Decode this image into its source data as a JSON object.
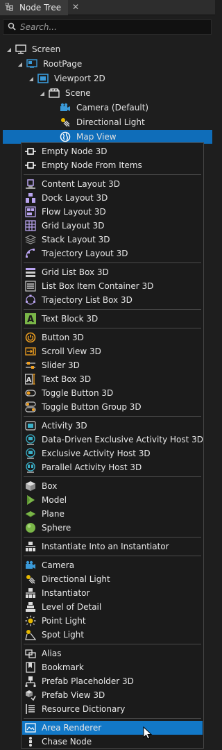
{
  "tab": {
    "title": "Node Tree"
  },
  "search": {
    "placeholder": "Search..."
  },
  "tree": [
    {
      "label": "Screen",
      "icon": "screen-icon"
    },
    {
      "label": "RootPage",
      "icon": "page-icon"
    },
    {
      "label": "Viewport 2D",
      "icon": "viewport-icon"
    },
    {
      "label": "Scene",
      "icon": "scene-icon"
    },
    {
      "label": "Camera (Default)",
      "icon": "camera-icon"
    },
    {
      "label": "Directional Light",
      "icon": "directional-light-icon"
    },
    {
      "label": "Map View",
      "icon": "map-view-icon"
    }
  ],
  "menu": {
    "items": [
      {
        "label": "Empty Node 3D",
        "icon": "empty-node-icon"
      },
      {
        "label": "Empty Node From Items",
        "icon": "empty-node-icon"
      },
      {
        "label": "Content Layout 3D",
        "icon": "content-layout-icon"
      },
      {
        "label": "Dock Layout 3D",
        "icon": "dock-layout-icon"
      },
      {
        "label": "Flow Layout 3D",
        "icon": "flow-layout-icon"
      },
      {
        "label": "Grid Layout 3D",
        "icon": "grid-layout-icon"
      },
      {
        "label": "Stack Layout 3D",
        "icon": "stack-layout-icon"
      },
      {
        "label": "Trajectory Layout 3D",
        "icon": "trajectory-layout-icon"
      },
      {
        "label": "Grid List Box 3D",
        "icon": "grid-list-box-icon"
      },
      {
        "label": "List Box Item Container 3D",
        "icon": "list-box-icon"
      },
      {
        "label": "Trajectory List Box 3D",
        "icon": "trajectory-list-icon"
      },
      {
        "label": "Text Block 3D",
        "icon": "text-block-icon"
      },
      {
        "label": "Button 3D",
        "icon": "button-icon"
      },
      {
        "label": "Scroll View 3D",
        "icon": "scroll-view-icon"
      },
      {
        "label": "Slider 3D",
        "icon": "slider-icon"
      },
      {
        "label": "Text Box 3D",
        "icon": "text-box-icon"
      },
      {
        "label": "Toggle Button 3D",
        "icon": "toggle-button-icon"
      },
      {
        "label": "Toggle Button Group 3D",
        "icon": "toggle-group-icon"
      },
      {
        "label": "Activity 3D",
        "icon": "activity-icon"
      },
      {
        "label": "Data-Driven Exclusive Activity Host 3D",
        "icon": "activity-host-icon"
      },
      {
        "label": "Exclusive Activity Host 3D",
        "icon": "activity-host-icon"
      },
      {
        "label": "Parallel Activity Host 3D",
        "icon": "activity-host-icon"
      },
      {
        "label": "Box",
        "icon": "box-icon"
      },
      {
        "label": "Model",
        "icon": "model-icon"
      },
      {
        "label": "Plane",
        "icon": "plane-icon"
      },
      {
        "label": "Sphere",
        "icon": "sphere-icon"
      },
      {
        "label": "Instantiate Into an Instantiator",
        "icon": "instantiator-icon"
      },
      {
        "label": "Camera",
        "icon": "camera-icon"
      },
      {
        "label": "Directional Light",
        "icon": "directional-light-icon"
      },
      {
        "label": "Instantiator",
        "icon": "instantiator-icon"
      },
      {
        "label": "Level of Detail",
        "icon": "level-of-detail-icon"
      },
      {
        "label": "Point Light",
        "icon": "point-light-icon"
      },
      {
        "label": "Spot Light",
        "icon": "spot-light-icon"
      },
      {
        "label": "Alias",
        "icon": "alias-icon"
      },
      {
        "label": "Bookmark",
        "icon": "bookmark-icon"
      },
      {
        "label": "Prefab Placeholder 3D",
        "icon": "prefab-placeholder-icon"
      },
      {
        "label": "Prefab View 3D",
        "icon": "prefab-view-icon"
      },
      {
        "label": "Resource Dictionary",
        "icon": "resource-dictionary-icon"
      },
      {
        "label": "Area Renderer",
        "icon": "area-renderer-icon"
      },
      {
        "label": "Chase Node",
        "icon": "chase-node-icon"
      }
    ]
  },
  "colors": {
    "selection": "#0f6db9",
    "highlight": "#1278c7",
    "background": "#1e1e1e"
  }
}
